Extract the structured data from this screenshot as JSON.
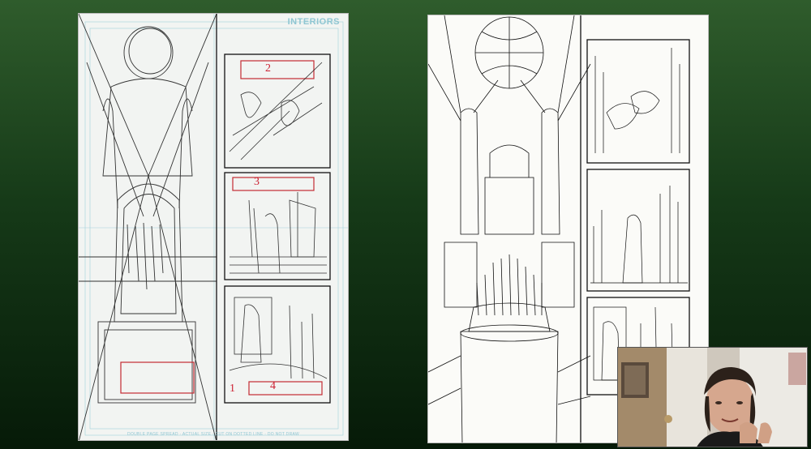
{
  "sketch_page": {
    "header_label": "INTERIORS",
    "footer_text": "DOUBLE PAGE SPREAD · ACTUAL SIZE · CUT ON DOTTED LINE · DO NOT DRAW",
    "panel_numbers": [
      "1",
      "2",
      "3",
      "4"
    ]
  },
  "inks_page": {},
  "webcam": {},
  "colors": {
    "bg_top": "#2f5c2c",
    "bg_bottom": "#061a08",
    "bluelines": "#8fc6d2",
    "panel_number_red": "#c23"
  }
}
